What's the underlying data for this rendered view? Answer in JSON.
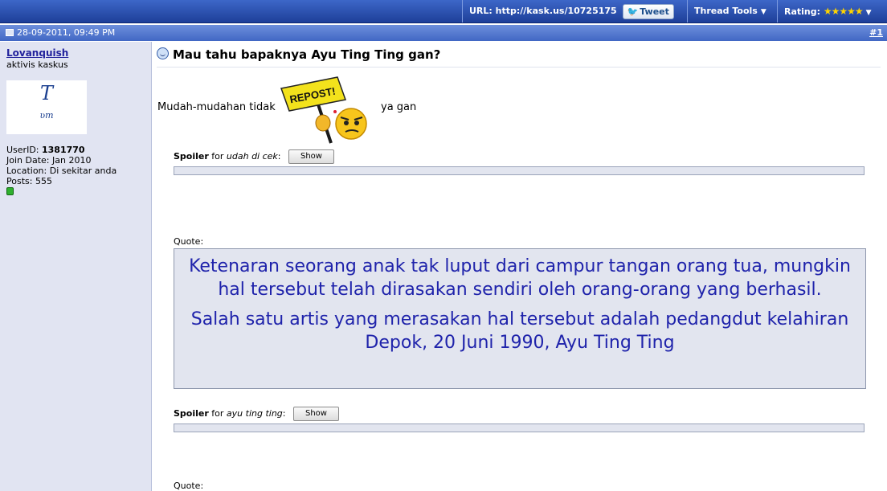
{
  "topbar": {
    "url_label": "URL: http://kask.us/10725175",
    "tweet_label": "Tweet",
    "thread_tools_label": "Thread Tools",
    "rating_label": "Rating:",
    "rating_stars": "★★★★★"
  },
  "post": {
    "date": "28-09-2011, 09:49 PM",
    "number": "#1",
    "title": "Mau tahu bapaknya Ayu Ting Ting gan?",
    "line_before": "Mudah-mudahan tidak",
    "line_after": "ya gan",
    "repost_sign": "REPOST!",
    "spoiler1": {
      "label": "Spoiler",
      "for": "for",
      "subject": "udah di cek",
      "button": "Show"
    },
    "quote1_label": "Quote:",
    "quote1_p1": "Ketenaran seorang anak tak luput dari campur tangan orang tua, mungkin hal tersebut telah dirasakan sendiri oleh orang-orang yang berhasil.",
    "quote1_p2": "Salah satu artis yang merasakan hal tersebut adalah pedangdut kelahiran Depok, 20 Juni 1990, Ayu Ting Ting",
    "spoiler2": {
      "label": "Spoiler",
      "for": "for",
      "subject": "ayu ting ting",
      "button": "Show"
    },
    "quote2_label": "Quote:"
  },
  "user": {
    "name": "Lovanquish",
    "title": "aktivis kaskus",
    "avatar_big": "T",
    "avatar_small": "ʋт",
    "userid_label": "UserID:",
    "userid": "1381770",
    "join": "Join Date: Jan 2010",
    "location": "Location: Di sekitar anda",
    "posts": "Posts: 555"
  }
}
